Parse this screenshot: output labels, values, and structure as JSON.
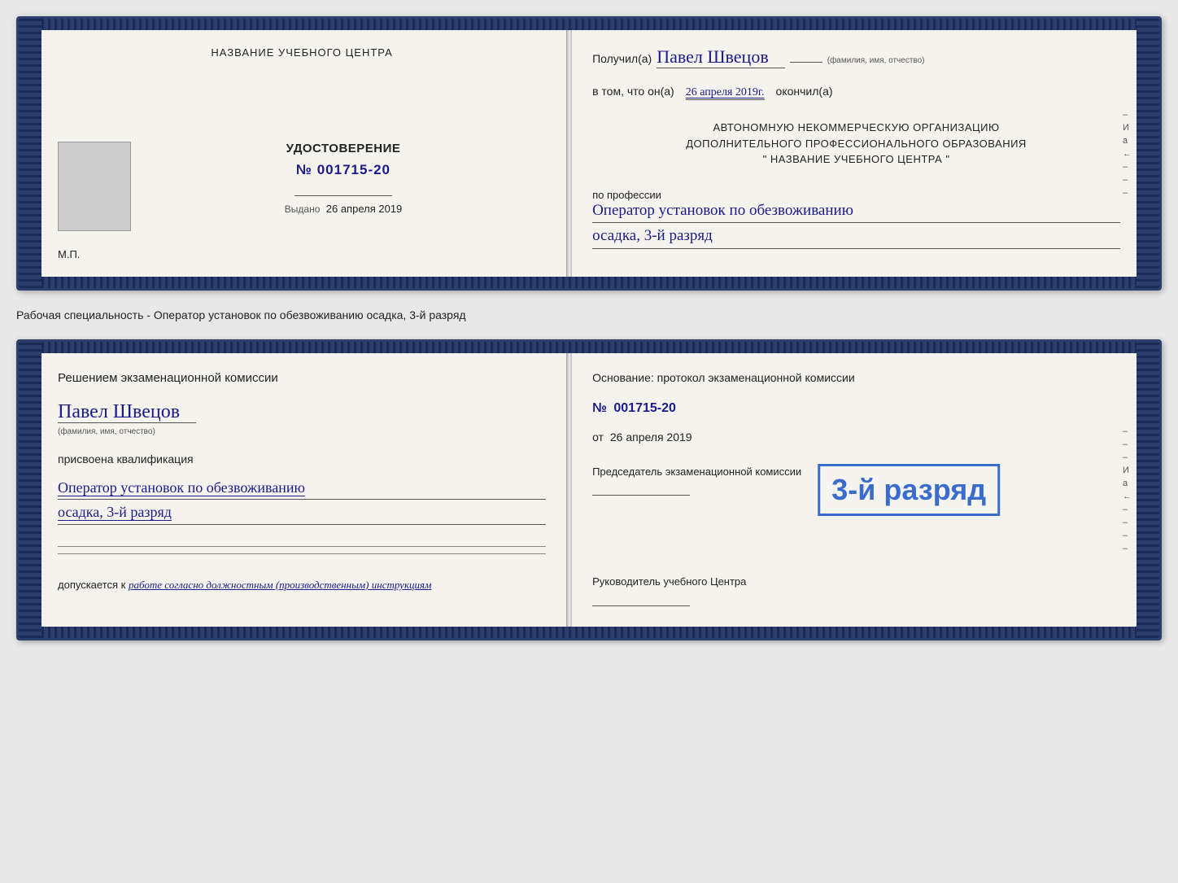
{
  "doc1": {
    "left": {
      "training_center_label": "НАЗВАНИЕ УЧЕБНОГО ЦЕНТРА",
      "cert_title": "УДОСТОВЕРЕНИЕ",
      "cert_number_prefix": "№",
      "cert_number": "001715-20",
      "issued_label": "Выдано",
      "issued_date": "26 апреля 2019",
      "mp_label": "М.П."
    },
    "right": {
      "received_label": "Получил(а)",
      "recipient_name": "Павел Швецов",
      "name_subtext": "(фамилия, имя, отчество)",
      "in_that_label": "в том, что он(а)",
      "completed_date": "26 апреля 2019г.",
      "completed_label": "окончил(а)",
      "org_line1": "АВТОНОМНУЮ НЕКОММЕРЧЕСКУЮ ОРГАНИЗАЦИЮ",
      "org_line2": "ДОПОЛНИТЕЛЬНОГО ПРОФЕССИОНАЛЬНОГО ОБРАЗОВАНИЯ",
      "org_line3": "\"    НАЗВАНИЕ УЧЕБНОГО ЦЕНТРА    \"",
      "profession_label": "по профессии",
      "profession_line1": "Оператор установок по обезвоживанию",
      "profession_line2": "осадка, 3-й разряд"
    }
  },
  "descriptor": "Рабочая специальность - Оператор установок по обезвоживанию осадка, 3-й разряд",
  "doc2": {
    "left": {
      "decision_label": "Решением экзаменационной комиссии",
      "person_name": "Павел Швецов",
      "name_subtext": "(фамилия, имя, отчество)",
      "assigned_label": "присвоена квалификация",
      "qualification_line1": "Оператор установок по обезвоживанию",
      "qualification_line2": "осадка, 3-й разряд",
      "allowed_label": "допускается к",
      "allowed_text": "работе согласно должностным (производственным) инструкциям"
    },
    "right": {
      "basis_label": "Основание: протокол экзаменационной комиссии",
      "protocol_prefix": "№",
      "protocol_number": "001715-20",
      "date_prefix": "от",
      "protocol_date": "26 апреля 2019",
      "chairman_label": "Председатель экзаменационной комиссии",
      "head_label": "Руководитель учебного Центра"
    },
    "stamp_text": "3-й разряд"
  },
  "side_chars_right": [
    "–",
    "И",
    "а",
    "←",
    "–",
    "–",
    "–",
    "–"
  ]
}
